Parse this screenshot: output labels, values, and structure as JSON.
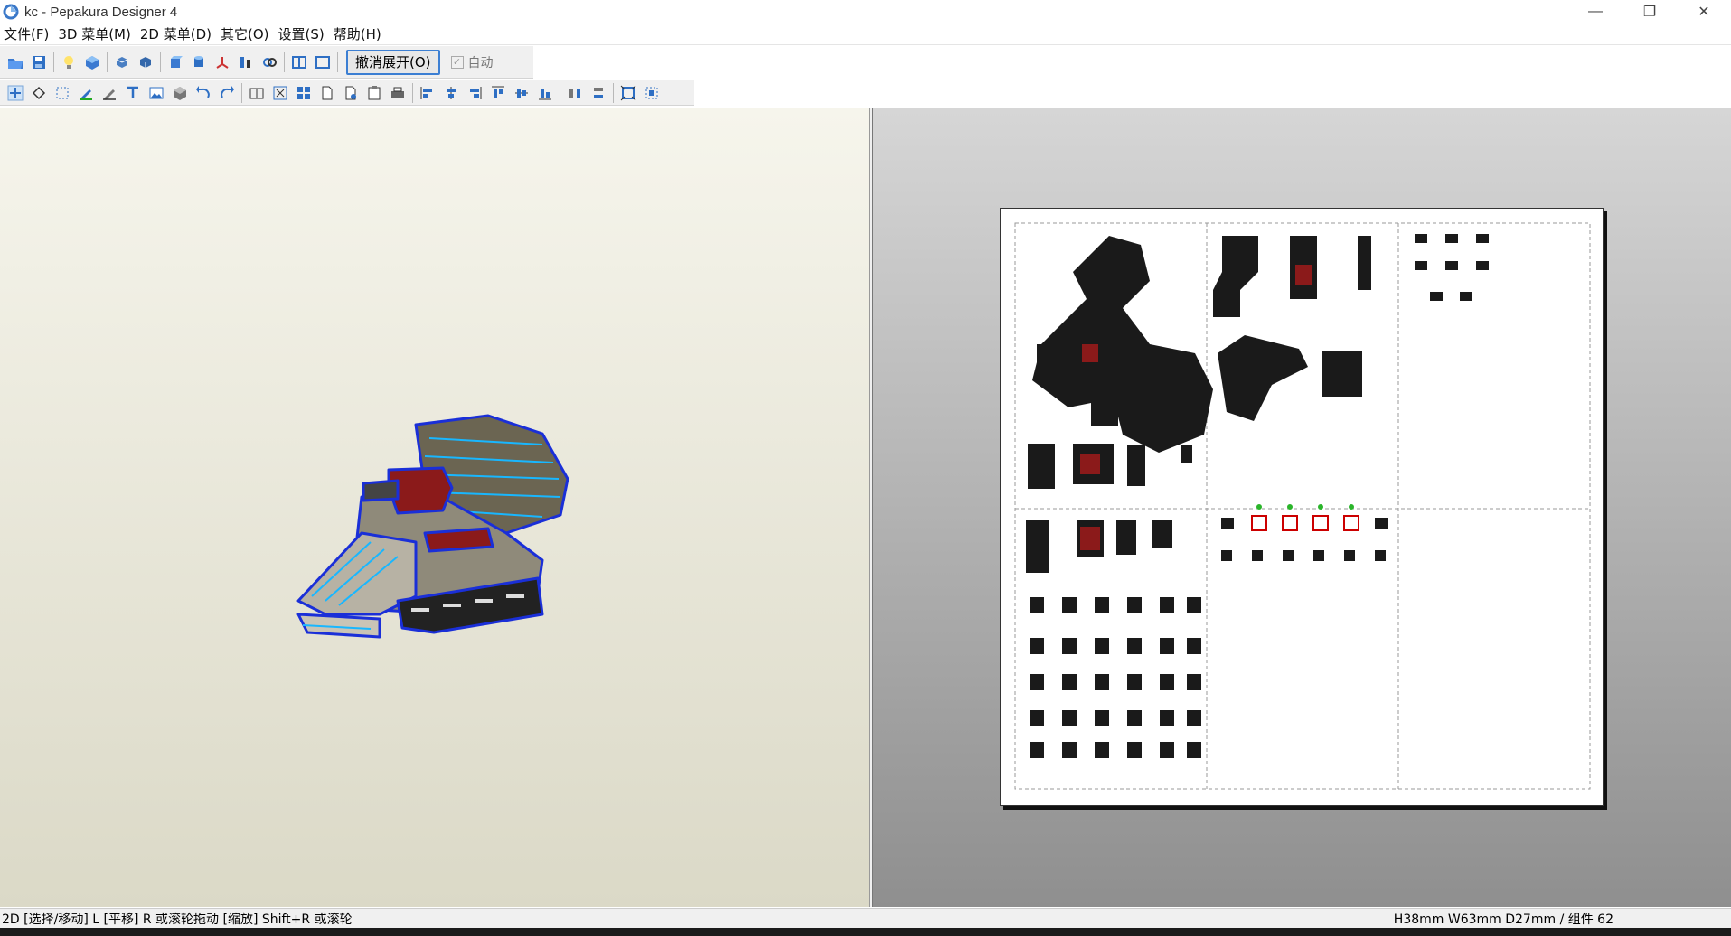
{
  "window": {
    "title": "kc - Pepakura Designer 4",
    "minimize": "—",
    "restore": "❐",
    "close": "✕"
  },
  "menu": [
    "文件(F)",
    "3D 菜单(M)",
    "2D 菜单(D)",
    "其它(O)",
    "设置(S)",
    "帮助(H)"
  ],
  "toolbar": {
    "unfold_label": "撤消展开(O)",
    "auto_label": "自动",
    "auto_checked": true
  },
  "status": {
    "left": "2D [选择/移动] L [平移] R 或滚轮拖动 [缩放] Shift+R 或滚轮",
    "right": "H38mm W63mm D27mm / 组件 62"
  },
  "colors": {
    "accent": "#3c7fd3",
    "model_outline": "#1a2fd8",
    "model_red": "#8b1a1a",
    "part_dark": "#1a1a1a"
  }
}
